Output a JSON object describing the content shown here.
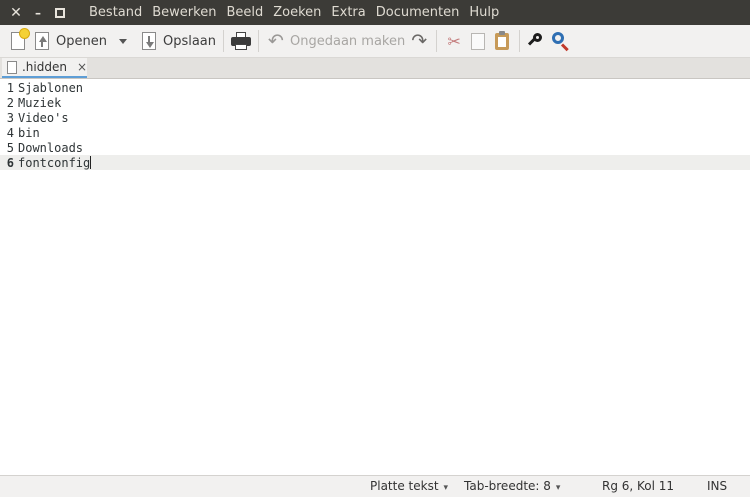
{
  "menubar": {
    "items": [
      "Bestand",
      "Bewerken",
      "Beeld",
      "Zoeken",
      "Extra",
      "Documenten",
      "Hulp"
    ]
  },
  "toolbar": {
    "open_label": "Openen",
    "save_label": "Opslaan",
    "undo_label": "Ongedaan maken"
  },
  "tab": {
    "title": ".hidden",
    "close_glyph": "×"
  },
  "editor": {
    "current_line": 6,
    "lines": [
      {
        "number": "1",
        "text": "Sjablonen"
      },
      {
        "number": "2",
        "text": "Muziek"
      },
      {
        "number": "3",
        "text": "Video's"
      },
      {
        "number": "4",
        "text": "bin"
      },
      {
        "number": "5",
        "text": "Downloads"
      },
      {
        "number": "6",
        "text": "fontconfig"
      }
    ]
  },
  "statusbar": {
    "language": "Platte tekst",
    "tab_width": "Tab-breedte: 8",
    "position": "Rg 6, Kol 11",
    "mode": "INS"
  },
  "colors": {
    "menubar_bg": "#3c3b37",
    "tab_accent": "#5e9ed6",
    "current_line_bg": "#eeeeec"
  }
}
